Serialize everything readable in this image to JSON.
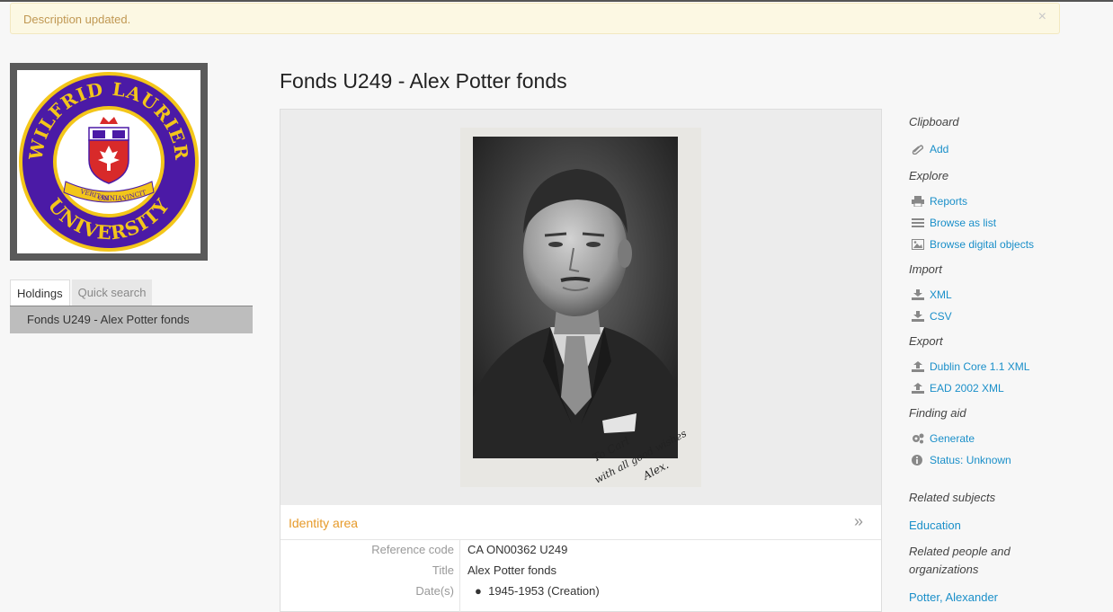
{
  "alert": {
    "message": "Description updated.",
    "close_glyph": "×"
  },
  "logo": {
    "ring_top_text": "WILFRID LAURIER",
    "ring_bottom_text": "UNIVERSITY",
    "motto_left": "VERITAS",
    "motto_center": "OMNIA",
    "motto_right": "VINCIT",
    "colors": {
      "purple": "#4b1aa6",
      "gold": "#f3c61a",
      "red": "#d82a2a"
    }
  },
  "left_nav": {
    "tabs": [
      {
        "label": "Holdings"
      },
      {
        "label": "Quick search"
      }
    ],
    "tree_item": "Fonds U249 - Alex Potter fonds"
  },
  "page_title": "Fonds U249 - Alex Potter fonds",
  "photo": {
    "inscription_line1": "To Carl",
    "inscription_line2": "with all good wishes",
    "inscription_line3": "Alex."
  },
  "identity_area": {
    "title": "Identity area",
    "toggle_glyph": "»",
    "fields": [
      {
        "label": "Reference code",
        "value": "CA ON00362 U249"
      },
      {
        "label": "Title",
        "value": "Alex Potter fonds"
      },
      {
        "label": "Date(s)",
        "value": "1945-1953 (Creation)"
      }
    ]
  },
  "sidebar": {
    "clipboard": {
      "heading": "Clipboard",
      "add": "Add"
    },
    "explore": {
      "heading": "Explore",
      "reports": "Reports",
      "browse_list": "Browse as list",
      "browse_digital": "Browse digital objects"
    },
    "import": {
      "heading": "Import",
      "xml": "XML",
      "csv": "CSV"
    },
    "export": {
      "heading": "Export",
      "dc": "Dublin Core 1.1 XML",
      "ead": "EAD 2002 XML"
    },
    "finding_aid": {
      "heading": "Finding aid",
      "generate": "Generate",
      "status": "Status: Unknown"
    },
    "related_subjects": {
      "heading": "Related subjects",
      "item": "Education"
    },
    "related_people": {
      "heading_line1": "Related people and",
      "heading_line2": "organizations",
      "item": "Potter, Alexander"
    }
  },
  "colors": {
    "link": "#1a8fc9",
    "section_title": "#e69a2a",
    "alert_bg": "#fcf8e3",
    "alert_text": "#c09853"
  }
}
